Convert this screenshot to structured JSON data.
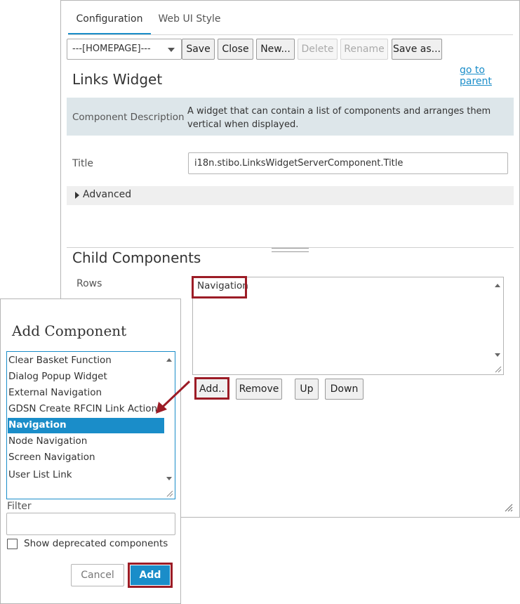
{
  "tabs": {
    "configuration": "Configuration",
    "web_ui_style": "Web UI Style"
  },
  "toolbar": {
    "selector_value": "---[HOMEPAGE]---",
    "save": "Save",
    "close": "Close",
    "new": "New...",
    "delete": "Delete",
    "rename": "Rename",
    "save_as": "Save as..."
  },
  "go_to_parent": "go to parent",
  "widget_title": "Links Widget",
  "description": {
    "label": "Component Description",
    "text": "A widget that can contain a list of components and arranges them vertical when displayed."
  },
  "title_field": {
    "label": "Title",
    "value": "i18n.stibo.LinksWidgetServerComponent.Title"
  },
  "advanced_label": "Advanced",
  "child_components": {
    "heading": "Child Components",
    "rows_label": "Rows",
    "rows": [
      "Navigation"
    ],
    "buttons": {
      "add": "Add..",
      "remove": "Remove",
      "up": "Up",
      "down": "Down"
    }
  },
  "dialog": {
    "title": "Add Component",
    "items": [
      "Clear Basket Function",
      "Dialog Popup Widget",
      "External Navigation",
      "GDSN Create RFCIN Link Action",
      "Navigation",
      "Node Navigation",
      "Screen Navigation",
      "User List Link"
    ],
    "selected_item": "Navigation",
    "filter_label": "Filter",
    "filter_value": "",
    "show_deprecated_label": "Show deprecated components",
    "show_deprecated_checked": false,
    "cancel": "Cancel",
    "add": "Add"
  },
  "colors": {
    "accent": "#1a8dc9",
    "highlight": "#9c1c26",
    "description_bg": "#dde6ea"
  }
}
